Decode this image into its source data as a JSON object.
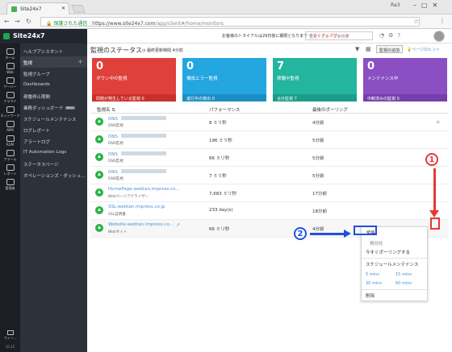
{
  "browser": {
    "tab_title": "Site24x7",
    "window_user": "Ra3",
    "url_secure_label": "保護された通信",
    "url_host": "https://www.site24x7.com",
    "url_path": "/app/client#/home/monitors"
  },
  "header": {
    "logo_text": "Site24x7",
    "trial_text": "お客様のトライアルは29日後に期限となります",
    "upgrade_text": "今すぐアップグレード",
    "search_placeholder": "監視・グループの検索"
  },
  "sidebar_icons": [
    {
      "label": "ホーム"
    },
    {
      "label": "Web"
    },
    {
      "label": "サーバー"
    },
    {
      "label": "クラウド"
    },
    {
      "label": "ネットワーク"
    },
    {
      "label": "APM"
    },
    {
      "label": "RUM"
    },
    {
      "label": "アラーム"
    },
    {
      "label": "レポート"
    },
    {
      "label": "管理者"
    }
  ],
  "sidebar_footer": {
    "feedback": "フィー...",
    "version": "10.15"
  },
  "nav": {
    "items": [
      {
        "label": "ヘルプアシスタント"
      },
      {
        "label": "監視"
      },
      {
        "label": "監視グループ"
      },
      {
        "label": "Dashboards"
      },
      {
        "label": "稼働停止期間"
      },
      {
        "label": "業務ダッシュボード",
        "badge": "NEW"
      },
      {
        "label": "スケジュールメンテナンス"
      },
      {
        "label": "ログレポート"
      },
      {
        "label": "アラートログ"
      },
      {
        "label": "IT Automation Logs"
      },
      {
        "label": "ステータスページ"
      },
      {
        "label": "オペレーションズ・ダッシュ..."
      }
    ]
  },
  "main": {
    "title": "監視のステータス",
    "refresh": "最終更新時間 4分前",
    "add_button": "監視の追加",
    "page_hint": "ページのヒント"
  },
  "tiles": [
    {
      "count": "0",
      "label": "ダウン中の監視",
      "footer": "問題が発生している監視 0",
      "color": "#e0403a",
      "footer_color": "#c9302b"
    },
    {
      "count": "0",
      "label": "構成エラー監視",
      "footer": "進行中の検出 0",
      "color": "#24a6e0",
      "footer_color": "#1b8ec3"
    },
    {
      "count": "7",
      "label": "稼働中監視",
      "footer": "合計監視 7",
      "color": "#24b59f",
      "footer_color": "#1a9d89"
    },
    {
      "count": "0",
      "label": "メンテナンス中",
      "footer": "中断済みの監視 0",
      "color": "#8a4fc3",
      "footer_color": "#7540ab"
    }
  ],
  "table": {
    "headers": [
      "監視名",
      "パフォーマンス",
      "最後のポーリング"
    ],
    "rows": [
      {
        "name": "DNS",
        "type": "DNS監視",
        "perf": "8 ミリ秒",
        "poll": "4分前"
      },
      {
        "name": "DNS",
        "type": "DNS監視",
        "perf": "196 ミリ秒",
        "poll": "5分前"
      },
      {
        "name": "DNS",
        "type": "DNS監視",
        "perf": "66 ミリ秒",
        "poll": "5分前"
      },
      {
        "name": "DNS",
        "type": "DNS監視",
        "perf": "7 ミリ秒",
        "poll": "5分前"
      },
      {
        "name": "HomePage-webtan.impress.co...",
        "type": "Webページアナライザー",
        "perf": "7,683 ミリ秒",
        "poll": "17分前"
      },
      {
        "name": "SSL-webtan.impress.co.jp",
        "type": "SSL証明書",
        "perf": "233 day(s)",
        "poll": "18分前"
      },
      {
        "name": "Website-webtan.impress.co...",
        "type": "Webサイト",
        "perf": "66 ミリ秒",
        "poll": "4分前"
      }
    ]
  },
  "dropdown": {
    "edit": "編集",
    "disable": "無効化",
    "poll_now": "今すぐポーリングする",
    "schedule": "スケジュールメンテナンス",
    "mins": [
      "5 mins",
      "15 mins",
      "30 mins",
      "60 mins"
    ],
    "delete": "削除"
  },
  "annotations": {
    "one": "1",
    "two": "2",
    "red": "#e53935",
    "blue": "#1f4fe0"
  }
}
